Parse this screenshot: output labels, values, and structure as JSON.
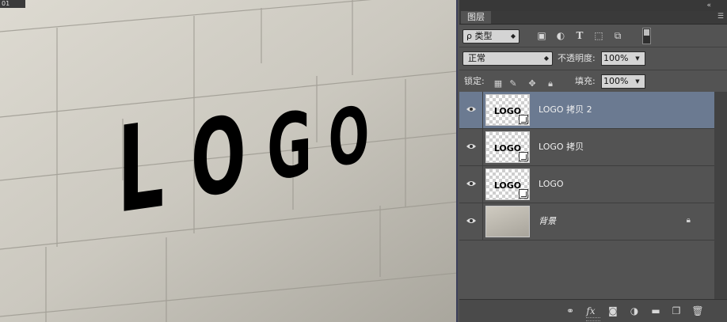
{
  "canvas": {
    "tab_label": "01",
    "logo_text": "LOGO"
  },
  "panel": {
    "tab": "图层",
    "filter": {
      "label": "ρ 类型"
    },
    "blend_mode": "正常",
    "opacity_label": "不透明度:",
    "opacity_value": "100%",
    "lock_label": "锁定:",
    "fill_label": "填充:",
    "fill_value": "100%",
    "layers": [
      {
        "name": "LOGO 拷贝 2",
        "selected": true,
        "type": "smart",
        "thumb_text": "LOGO"
      },
      {
        "name": "LOGO 拷贝",
        "selected": false,
        "type": "smart",
        "thumb_text": "LOGO"
      },
      {
        "name": "LOGO",
        "selected": false,
        "type": "smart",
        "thumb_text": "LOGO"
      },
      {
        "name": "背景",
        "selected": false,
        "type": "background",
        "locked": true
      }
    ],
    "colors": {
      "panel_bg": "#535353",
      "selected_layer": "#6b7a91"
    }
  }
}
